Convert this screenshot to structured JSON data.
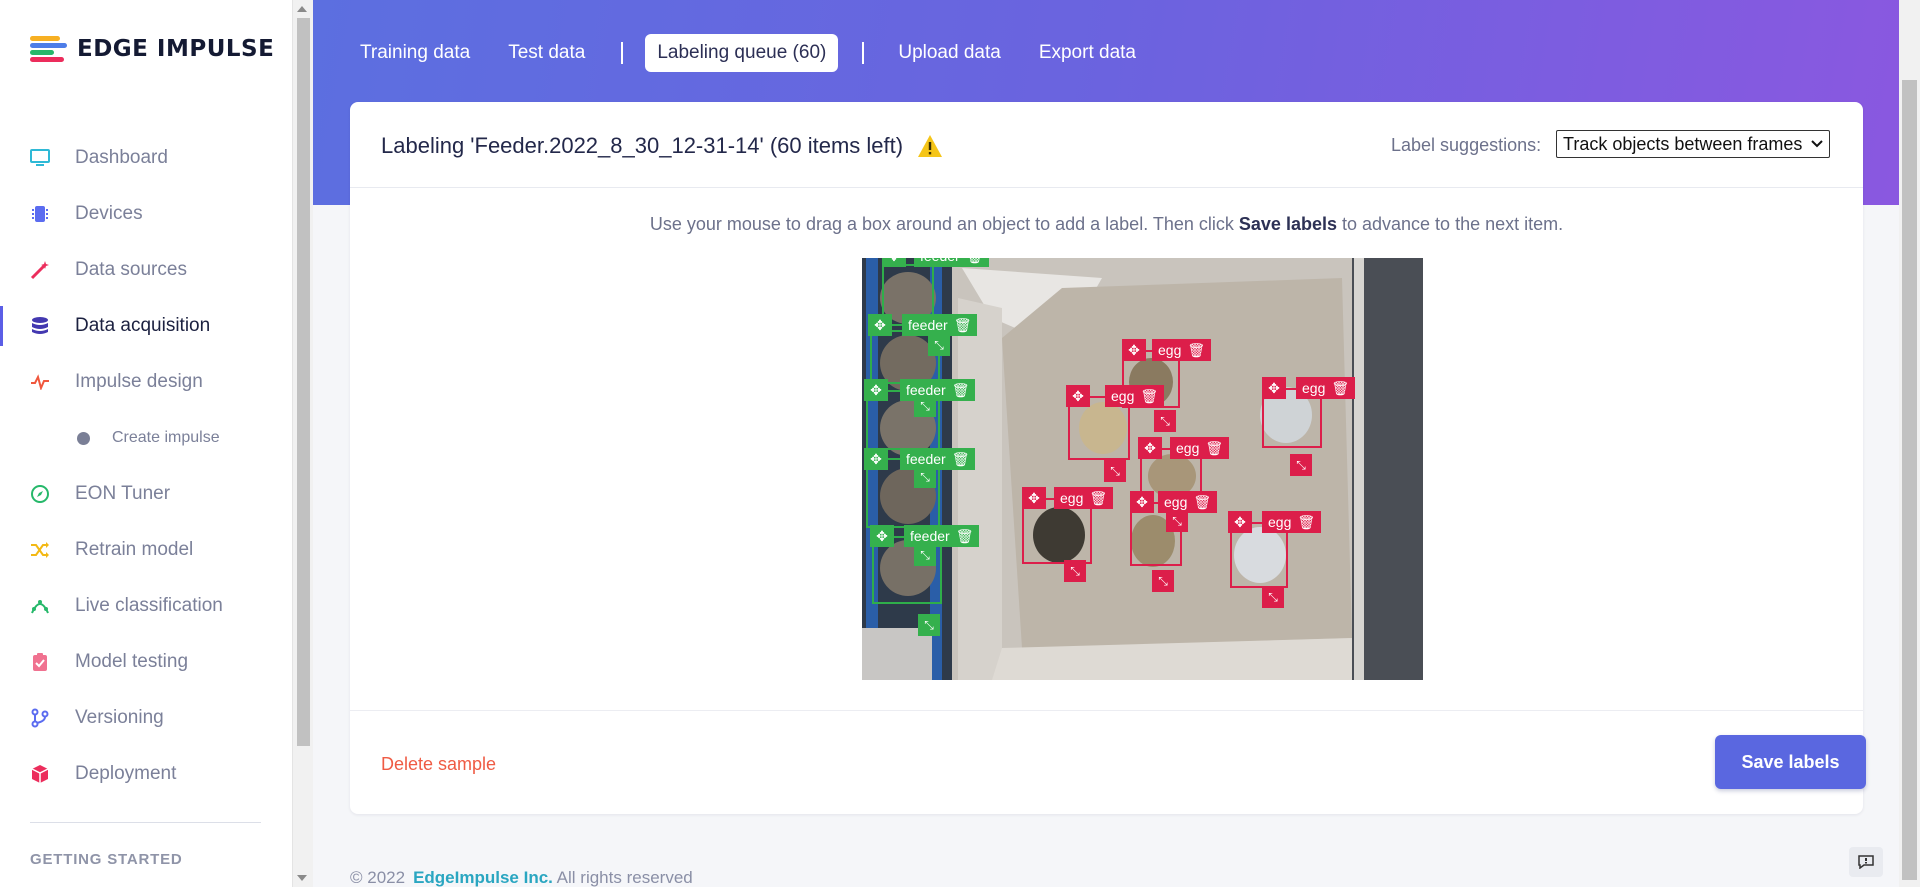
{
  "brand": {
    "name": "EDGE IMPULSE"
  },
  "sidebar": {
    "items": [
      {
        "label": "Dashboard",
        "icon": "monitor-icon",
        "color": "#2fb9d6"
      },
      {
        "label": "Devices",
        "icon": "chip-icon",
        "color": "#5b6cf0"
      },
      {
        "label": "Data sources",
        "icon": "wand-icon",
        "color": "#ec2d5c"
      },
      {
        "label": "Data acquisition",
        "icon": "database-icon",
        "color": "#4338b0",
        "active": true
      },
      {
        "label": "Impulse design",
        "icon": "pulse-icon",
        "color": "#f0573d"
      },
      {
        "label": "EON Tuner",
        "icon": "compass-icon",
        "color": "#26b86a"
      },
      {
        "label": "Retrain model",
        "icon": "shuffle-icon",
        "color": "#f3b915"
      },
      {
        "label": "Live classification",
        "icon": "signal-icon",
        "color": "#26b86a"
      },
      {
        "label": "Model testing",
        "icon": "clipboard-check-icon",
        "color": "#f07290"
      },
      {
        "label": "Versioning",
        "icon": "branch-icon",
        "color": "#5b6cf0"
      },
      {
        "label": "Deployment",
        "icon": "cube-icon",
        "color": "#ec2d5c"
      }
    ],
    "sub_item": "Create impulse",
    "section_heading": "GETTING STARTED"
  },
  "tabs": {
    "training": "Training data",
    "test": "Test data",
    "queue": "Labeling queue (60)",
    "upload": "Upload data",
    "export": "Export data"
  },
  "card": {
    "title": "Labeling 'Feeder.2022_8_30_12-31-14' (60 items left)",
    "suggest_label": "Label suggestions:",
    "suggest_value": "Track objects between frames",
    "instruction_pre": "Use your mouse to drag a box around an object to add a label. Then click ",
    "instruction_bold": "Save labels",
    "instruction_post": " to advance to the next item.",
    "delete": "Delete sample",
    "save": "Save labels"
  },
  "labels": {
    "feeder": "feeder",
    "egg": "egg"
  },
  "footer": {
    "copyright": "© 2022",
    "company": "EdgeImpulse Inc.",
    "rights": " All rights reserved"
  },
  "colors": {
    "accent": "#5a67e0",
    "feeder": "#35b04d",
    "egg": "#dc1e4a",
    "danger": "#ef5b44"
  }
}
